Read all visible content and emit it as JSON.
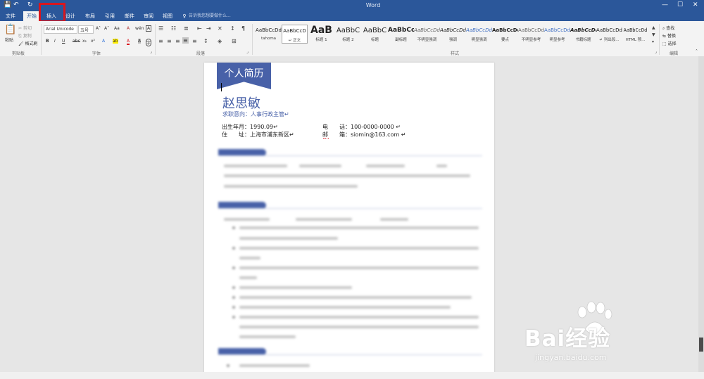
{
  "titlebar": {
    "doc_title": "Word",
    "qat": {
      "save": "💾",
      "undo": "↶",
      "redo": "↻"
    }
  },
  "tabs": [
    {
      "id": "file",
      "label": "文件"
    },
    {
      "id": "home",
      "label": "开始"
    },
    {
      "id": "insert",
      "label": "插入"
    },
    {
      "id": "design",
      "label": "设计"
    },
    {
      "id": "layout",
      "label": "布局"
    },
    {
      "id": "references",
      "label": "引用"
    },
    {
      "id": "mailings",
      "label": "邮件"
    },
    {
      "id": "review",
      "label": "审阅"
    },
    {
      "id": "view",
      "label": "视图"
    }
  ],
  "tell_me": "告诉我您想要做什么...",
  "clipboard": {
    "paste": "粘贴",
    "cut": "剪切",
    "copy": "复制",
    "format_painter": "格式刷",
    "group_label": "剪贴板"
  },
  "font": {
    "font_name": "Arial Unicode",
    "font_size": "五号",
    "bold": "B",
    "italic": "I",
    "underline": "U",
    "strike": "abc",
    "subscript": "x₂",
    "superscript": "x²",
    "grow": "A˄",
    "shrink": "A˅",
    "change_case": "Aa",
    "clear_format": "A",
    "phonetic": "wén",
    "border": "A",
    "text_effects": "A",
    "highlight": "ab",
    "font_color": "A",
    "shading": "A",
    "enclose": "字",
    "group_label": "字体"
  },
  "paragraph": {
    "group_label": "段落"
  },
  "styles": {
    "items": [
      {
        "sample": "AaBbCcDd",
        "name": "tahoma"
      },
      {
        "sample": "AaBbCcD",
        "name": "↵ 正文"
      },
      {
        "sample": "AaB",
        "name": "标题 1"
      },
      {
        "sample": "AaBbC",
        "name": "标题 2"
      },
      {
        "sample": "AaBbC",
        "name": "标题"
      },
      {
        "sample": "AaBbCc",
        "name": "副标题"
      },
      {
        "sample": "AaBbCcDd",
        "name": "不明显强调"
      },
      {
        "sample": "AaBbCcDd",
        "name": "强调"
      },
      {
        "sample": "AaBbCcDd",
        "name": "明显强调"
      },
      {
        "sample": "AaBbCcDd",
        "name": "要点"
      },
      {
        "sample": "AaBbCcDd",
        "name": "不明显参考"
      },
      {
        "sample": "AaBbCcDd",
        "name": "明显参考"
      },
      {
        "sample": "AaBbCcDd",
        "name": "书籍标题"
      },
      {
        "sample": "AaBbCcDd",
        "name": "↵ 列出段..."
      },
      {
        "sample": "AaBbCcDd",
        "name": "HTML 预..."
      }
    ],
    "group_label": "样式"
  },
  "editing": {
    "find": "查找",
    "replace": "替换",
    "select": "选择",
    "group_label": "编辑"
  },
  "resume": {
    "banner": "个人简历",
    "name": "赵思敏",
    "objective": "求职意向：人事行政主管↵",
    "birth_label": "出生年月：1990.09↵",
    "address_label": "住　　址：上海市浦东新区↵",
    "phone_label": "电　　话：100-0000-0000 ↵",
    "email_label": "邮　　箱：siomin@163.com ↵"
  },
  "watermark": {
    "brand": "Bai经验",
    "url": "jingyan.baidu.com"
  },
  "colors": {
    "accent": "#2b579a",
    "banner": "#4861a8",
    "highlight_box": "#d9161e"
  }
}
